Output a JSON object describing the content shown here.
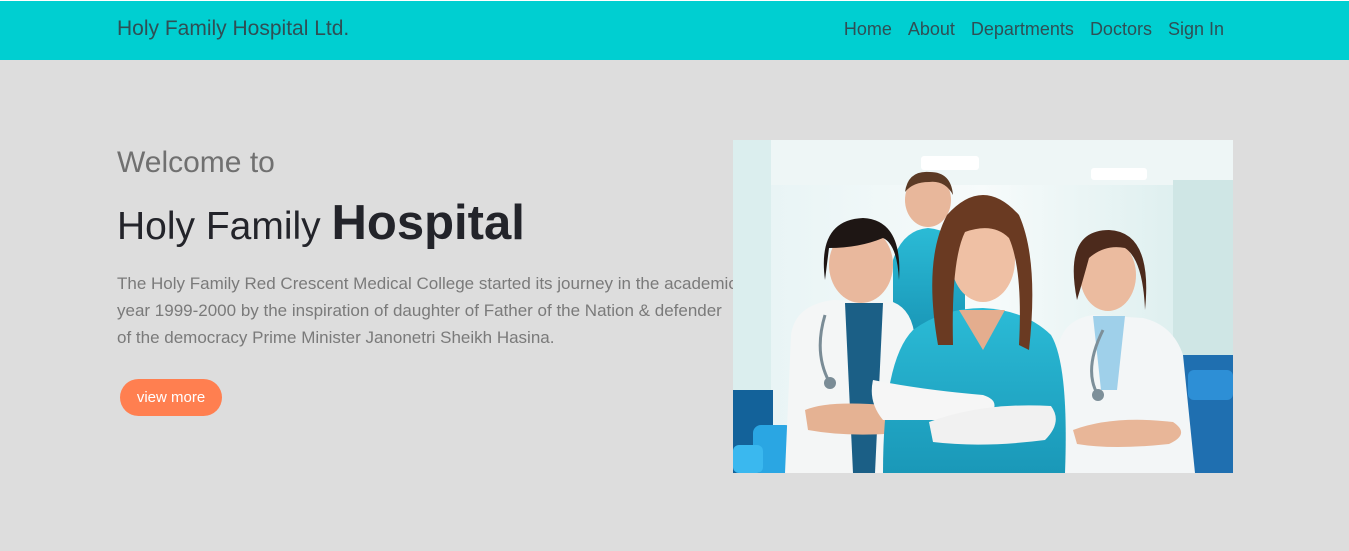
{
  "navbar": {
    "brand": "Holy Family Hospital Ltd.",
    "links": [
      "Home",
      "About",
      "Departments",
      "Doctors",
      "Sign In"
    ]
  },
  "hero": {
    "welcome": "Welcome to",
    "title_regular": "Holy Family",
    "title_bold": "Hospital",
    "description": "The Holy Family Red Crescent Medical College started its journey in the academic year 1999-2000 by the inspiration of daughter of Father of the Nation & defender of the democracy Prime Minister Janonetri Sheikh Hasina.",
    "button_label": "view more"
  },
  "colors": {
    "navbar_bg": "#00cfd1",
    "page_bg": "#dddddd",
    "accent_button": "#ff7f50"
  }
}
